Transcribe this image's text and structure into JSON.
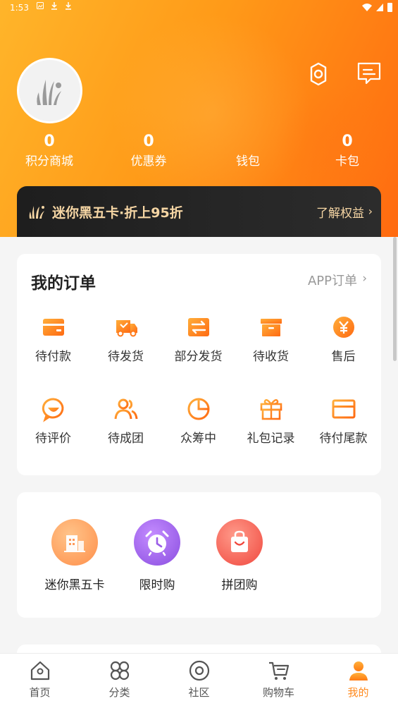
{
  "status_bar": {
    "time": "1:53"
  },
  "profile": {
    "stats": [
      {
        "value": "0",
        "label": "积分商城"
      },
      {
        "value": "0",
        "label": "优惠券"
      },
      {
        "value": "",
        "label": "钱包"
      },
      {
        "value": "0",
        "label": "卡包"
      }
    ]
  },
  "banner": {
    "title": "迷你黑五卡·折上95折",
    "link": "了解权益",
    "chevron": "›"
  },
  "orders": {
    "title": "我的订单",
    "link": "APP订单",
    "chevron": "›",
    "items": [
      {
        "label": "待付款",
        "icon": "wallet-icon"
      },
      {
        "label": "待发货",
        "icon": "truck-icon"
      },
      {
        "label": "部分发货",
        "icon": "exchange-icon"
      },
      {
        "label": "待收货",
        "icon": "box-icon"
      },
      {
        "label": "售后",
        "icon": "yen-icon"
      },
      {
        "label": "待评价",
        "icon": "comment-icon"
      },
      {
        "label": "待成团",
        "icon": "group-icon"
      },
      {
        "label": "众筹中",
        "icon": "pie-icon"
      },
      {
        "label": "礼包记录",
        "icon": "gift-icon"
      },
      {
        "label": "待付尾款",
        "icon": "card-icon"
      }
    ]
  },
  "services": {
    "items": [
      {
        "label": "迷你黑五卡",
        "icon": "building-icon"
      },
      {
        "label": "限时购",
        "icon": "alarm-clock-icon"
      },
      {
        "label": "拼团购",
        "icon": "shopping-bag-icon"
      }
    ]
  },
  "tabbar": {
    "items": [
      {
        "label": "首页",
        "icon": "home-icon"
      },
      {
        "label": "分类",
        "icon": "category-icon"
      },
      {
        "label": "社区",
        "icon": "community-icon"
      },
      {
        "label": "购物车",
        "icon": "cart-icon"
      },
      {
        "label": "我的",
        "icon": "user-icon"
      }
    ],
    "active_color": "#ff8a1e"
  },
  "colors": {
    "accent": "#ff7a1a",
    "banner_text": "#f6d6a4"
  }
}
